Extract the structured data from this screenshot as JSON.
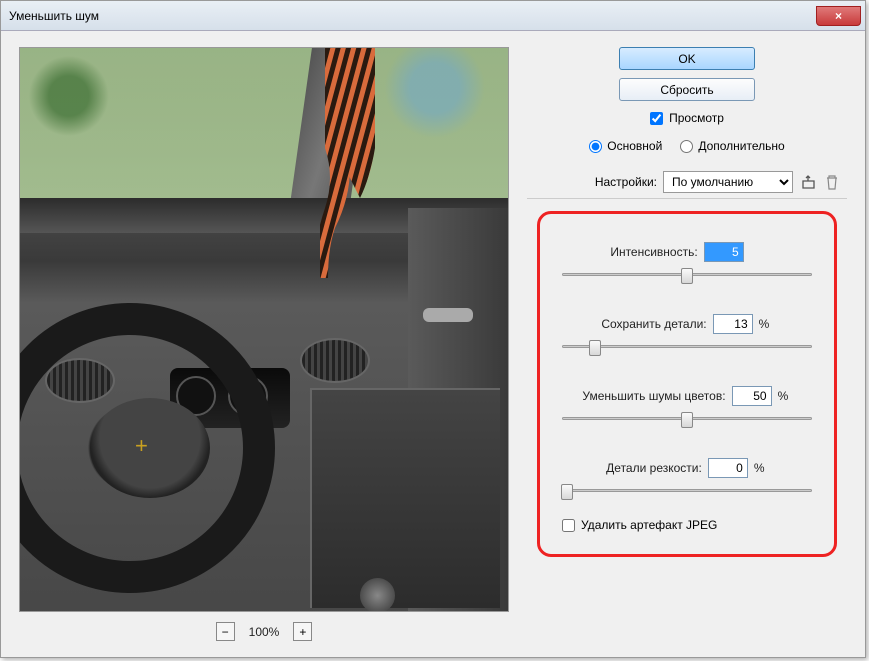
{
  "window": {
    "title": "Уменьшить шум"
  },
  "buttons": {
    "ok": "OK",
    "reset": "Сбросить",
    "close_x": "×"
  },
  "preview": {
    "checkbox_label": "Просмотр",
    "checked": true
  },
  "mode": {
    "basic": "Основной",
    "advanced": "Дополнительно",
    "selected": "basic"
  },
  "settings": {
    "label": "Настройки:",
    "selected": "По умолчанию",
    "save_icon": "save-preset-icon",
    "delete_icon": "delete-preset-icon"
  },
  "sliders": {
    "strength": {
      "label": "Интенсивность:",
      "value": "5",
      "max": 10,
      "percent": false
    },
    "preserve": {
      "label": "Сохранить детали:",
      "value": "13",
      "max": 100,
      "percent": true
    },
    "color": {
      "label": "Уменьшить шумы цветов:",
      "value": "50",
      "max": 100,
      "percent": true
    },
    "sharpen": {
      "label": "Детали резкости:",
      "value": "0",
      "max": 100,
      "percent": true
    }
  },
  "jpeg": {
    "label": "Удалить артефакт JPEG",
    "checked": false
  },
  "zoom": {
    "minus": "−",
    "plus": "+",
    "level": "100%"
  }
}
